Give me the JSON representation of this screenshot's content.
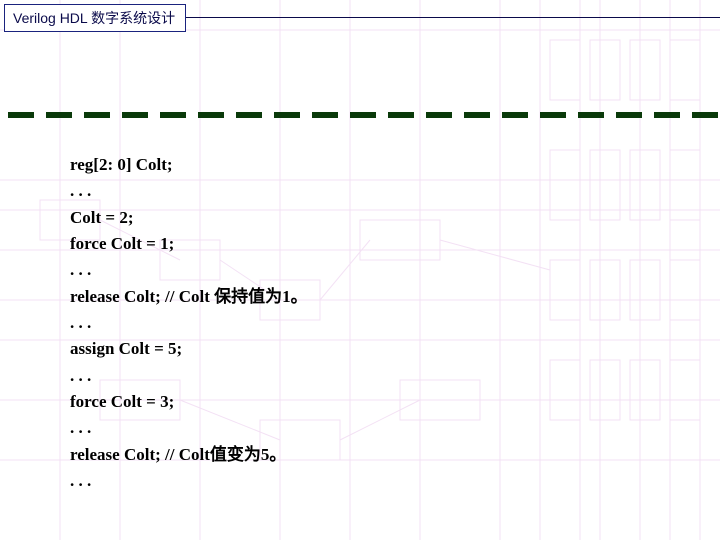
{
  "header": {
    "title": "Verilog HDL 数字系统设计"
  },
  "code": {
    "lines": [
      "reg[2: 0] Colt;",
      ". . .",
      "Colt = 2;",
      "force Colt = 1;",
      ". . .",
      "release Colt; // Colt 保持值为1。",
      ". . .",
      "assign Colt = 5;",
      ". . .",
      "force Colt = 3;",
      ". . .",
      "release Colt; // Colt值变为5。",
      ". . ."
    ]
  }
}
